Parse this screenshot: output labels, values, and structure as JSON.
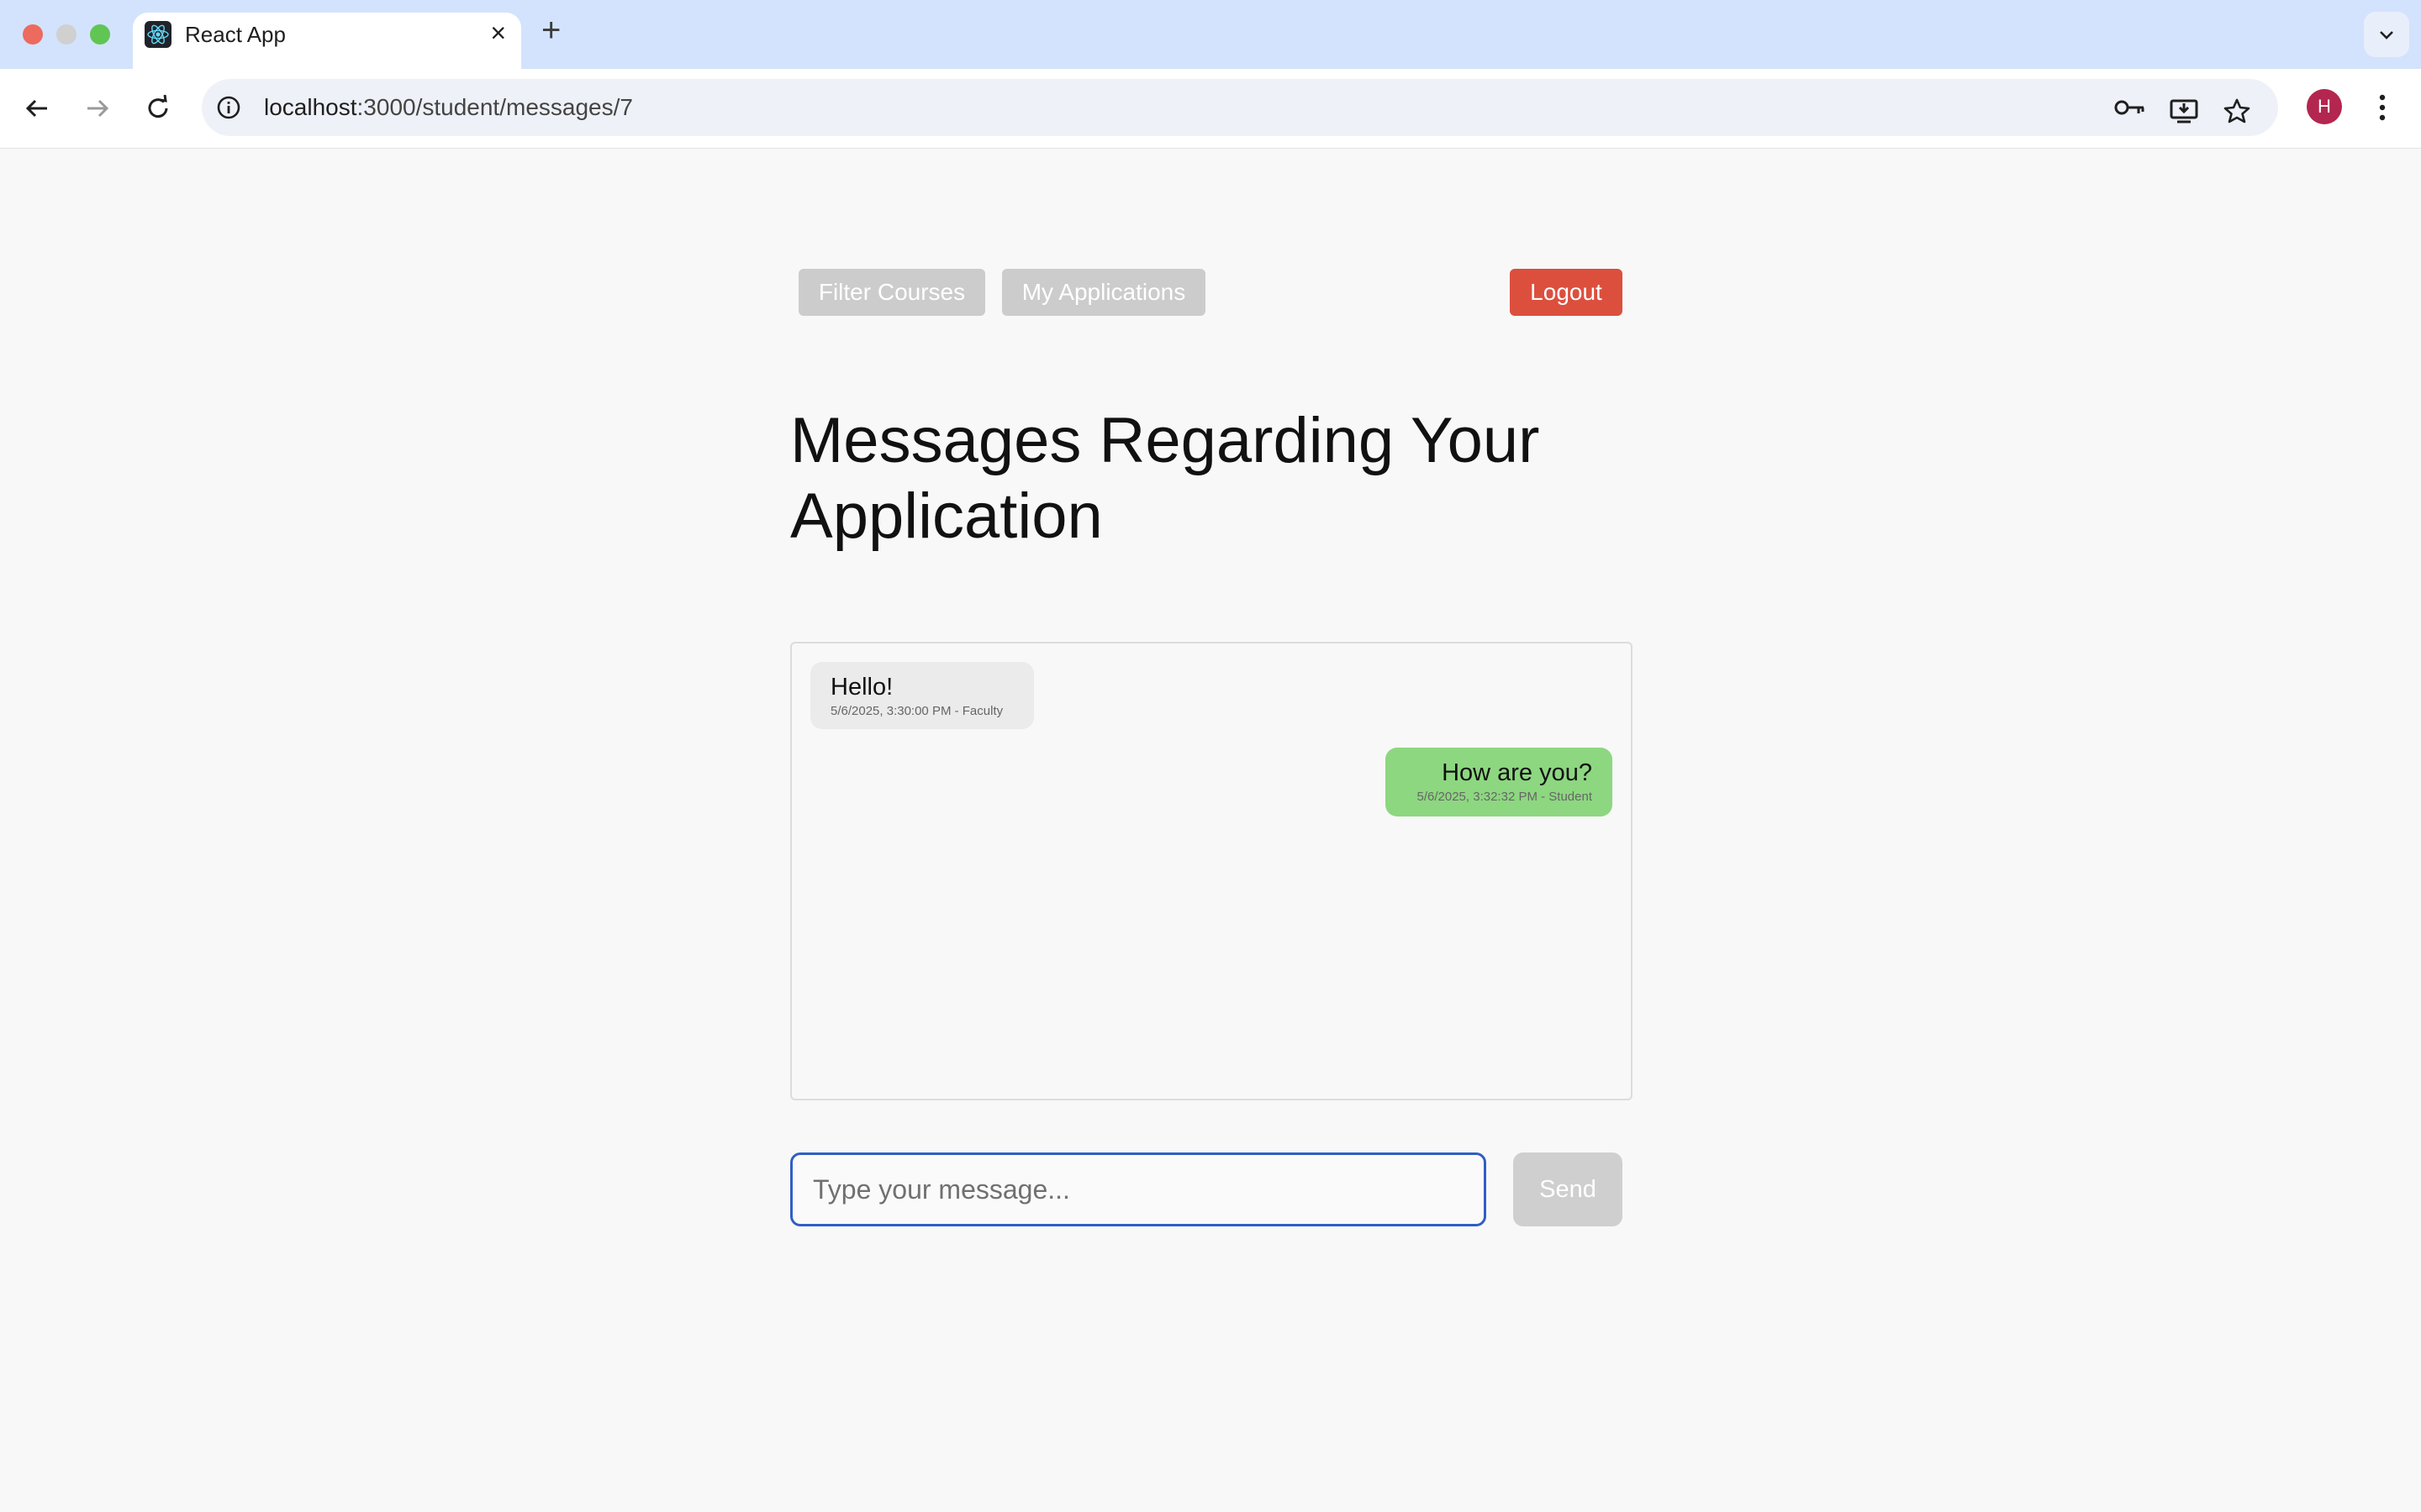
{
  "browser": {
    "tab_title": "React App",
    "url_host": "localhost",
    "url_path": ":3000/student/messages/7",
    "avatar_letter": "H"
  },
  "nav": {
    "filter_courses": "Filter Courses",
    "my_applications": "My Applications",
    "logout": "Logout"
  },
  "page": {
    "title": "Messages Regarding Your Application"
  },
  "messages": [
    {
      "text": "Hello!",
      "meta": "5/6/2025, 3:30:00 PM - Faculty",
      "sender": "Faculty"
    },
    {
      "text": "How are you?",
      "meta": "5/6/2025, 3:32:32 PM - Student",
      "sender": "Student"
    }
  ],
  "composer": {
    "placeholder": "Type your message...",
    "send_label": "Send"
  },
  "colors": {
    "logout": "#dc4f3d",
    "student_bubble": "#8dd780",
    "faculty_bubble": "#ebebeb",
    "input_focus": "#2f5fc4"
  }
}
